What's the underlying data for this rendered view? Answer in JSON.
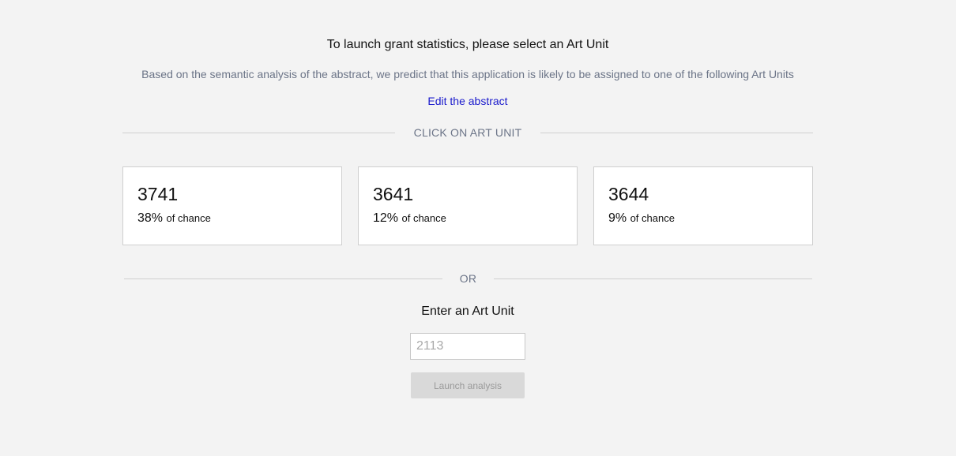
{
  "header": {
    "title": "To launch grant statistics, please select an Art Unit",
    "subtitle": "Based on the semantic analysis of the abstract, we predict that this application is likely to be assigned to one of the following Art Units",
    "edit_link": "Edit the abstract"
  },
  "dividers": {
    "click": "CLICK ON ART UNIT",
    "or": "OR"
  },
  "art_units": [
    {
      "unit": "3741",
      "percent": "38%",
      "suffix": "of chance"
    },
    {
      "unit": "3641",
      "percent": "12%",
      "suffix": "of chance"
    },
    {
      "unit": "3644",
      "percent": "9%",
      "suffix": "of chance"
    }
  ],
  "manual": {
    "label": "Enter an Art Unit",
    "placeholder": "2113",
    "button": "Launch analysis"
  }
}
